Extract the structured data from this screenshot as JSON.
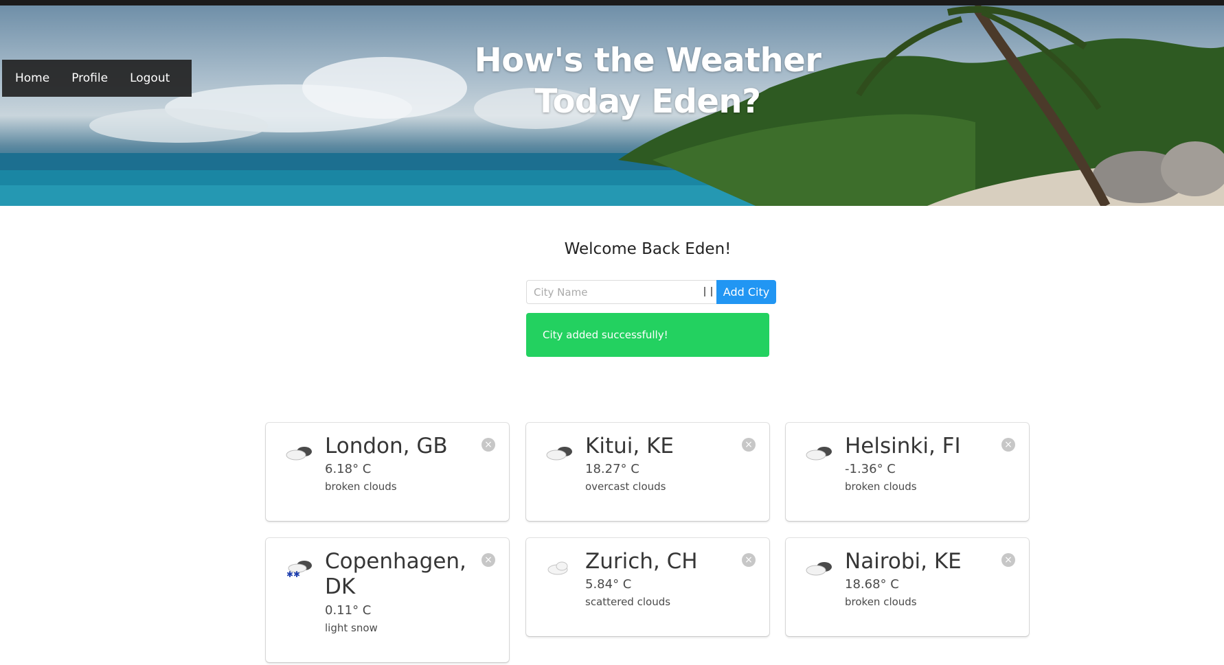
{
  "nav": {
    "items": [
      "Home",
      "Profile",
      "Logout"
    ]
  },
  "hero": {
    "title_line1": "How's the Weather",
    "title_line2": "Today Eden?"
  },
  "welcome": "Welcome Back Eden!",
  "form": {
    "placeholder": "City Name",
    "button_label": "Add City"
  },
  "notification": "City added successfully!",
  "colors": {
    "button": "#2196f3",
    "success": "#23d160",
    "nav_bg": "#232323"
  },
  "cities": [
    {
      "name": "London, GB",
      "temp": "6.18° C",
      "desc": "broken clouds",
      "icon": "broken-clouds-icon"
    },
    {
      "name": "Kitui, KE",
      "temp": "18.27° C",
      "desc": "overcast clouds",
      "icon": "overcast-clouds-icon"
    },
    {
      "name": "Helsinki, FI",
      "temp": "-1.36° C",
      "desc": "broken clouds",
      "icon": "broken-clouds-icon"
    },
    {
      "name": "Copenhagen, DK",
      "temp": "0.11° C",
      "desc": "light snow",
      "icon": "snow-icon"
    },
    {
      "name": "Zurich, CH",
      "temp": "5.84° C",
      "desc": "scattered clouds",
      "icon": "scattered-clouds-icon"
    },
    {
      "name": "Nairobi, KE",
      "temp": "18.68° C",
      "desc": "broken clouds",
      "icon": "broken-clouds-icon"
    }
  ],
  "close_glyph": "×"
}
